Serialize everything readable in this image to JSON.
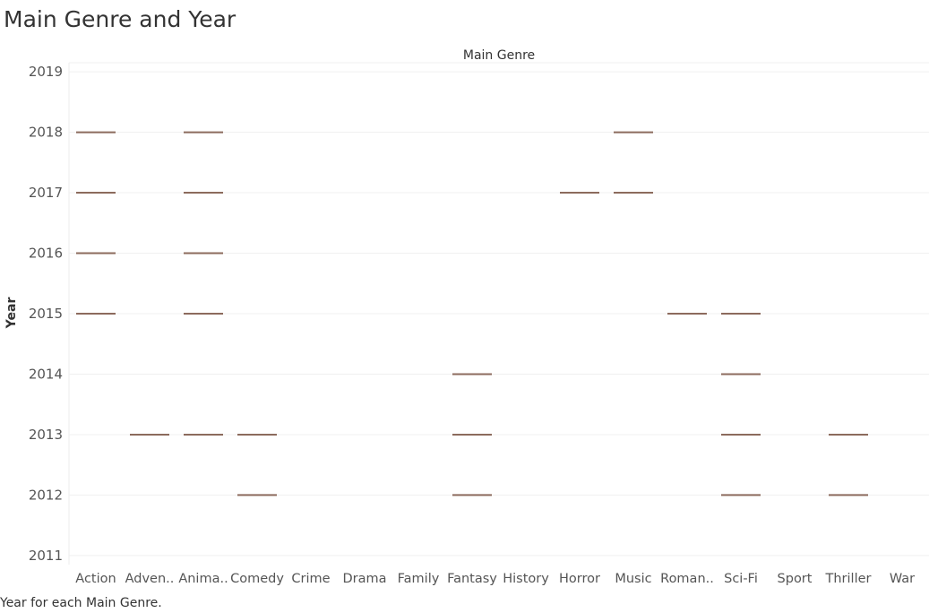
{
  "title": "Main Genre and Year",
  "caption": "Year for each Main Genre.",
  "chart_data": {
    "type": "scatter",
    "title": "Main Genre and Year",
    "xlabel": "Main Genre",
    "ylabel": "Year",
    "categories": [
      "Action",
      "Adven..",
      "Anima..",
      "Comedy",
      "Crime",
      "Drama",
      "Family",
      "Fantasy",
      "History",
      "Horror",
      "Music",
      "Roman..",
      "Sci-Fi",
      "Sport",
      "Thriller",
      "War"
    ],
    "y_ticks": [
      2011,
      2012,
      2013,
      2014,
      2015,
      2016,
      2017,
      2018,
      2019
    ],
    "ylim": [
      2010.85,
      2019.15
    ],
    "grid": true,
    "mark": "horizontal dash",
    "mark_color": "#8c6b5d",
    "points": [
      {
        "x": "Action",
        "y": 2015
      },
      {
        "x": "Action",
        "y": 2016
      },
      {
        "x": "Action",
        "y": 2017
      },
      {
        "x": "Action",
        "y": 2018
      },
      {
        "x": "Adven..",
        "y": 2013
      },
      {
        "x": "Anima..",
        "y": 2013
      },
      {
        "x": "Anima..",
        "y": 2015
      },
      {
        "x": "Anima..",
        "y": 2016
      },
      {
        "x": "Anima..",
        "y": 2017
      },
      {
        "x": "Anima..",
        "y": 2018
      },
      {
        "x": "Comedy",
        "y": 2012
      },
      {
        "x": "Comedy",
        "y": 2013
      },
      {
        "x": "Fantasy",
        "y": 2012
      },
      {
        "x": "Fantasy",
        "y": 2013
      },
      {
        "x": "Fantasy",
        "y": 2014
      },
      {
        "x": "Horror",
        "y": 2017
      },
      {
        "x": "Music",
        "y": 2017
      },
      {
        "x": "Music",
        "y": 2018
      },
      {
        "x": "Roman..",
        "y": 2015
      },
      {
        "x": "Sci-Fi",
        "y": 2012
      },
      {
        "x": "Sci-Fi",
        "y": 2013
      },
      {
        "x": "Sci-Fi",
        "y": 2014
      },
      {
        "x": "Sci-Fi",
        "y": 2015
      },
      {
        "x": "Thriller",
        "y": 2012
      },
      {
        "x": "Thriller",
        "y": 2013
      }
    ]
  }
}
